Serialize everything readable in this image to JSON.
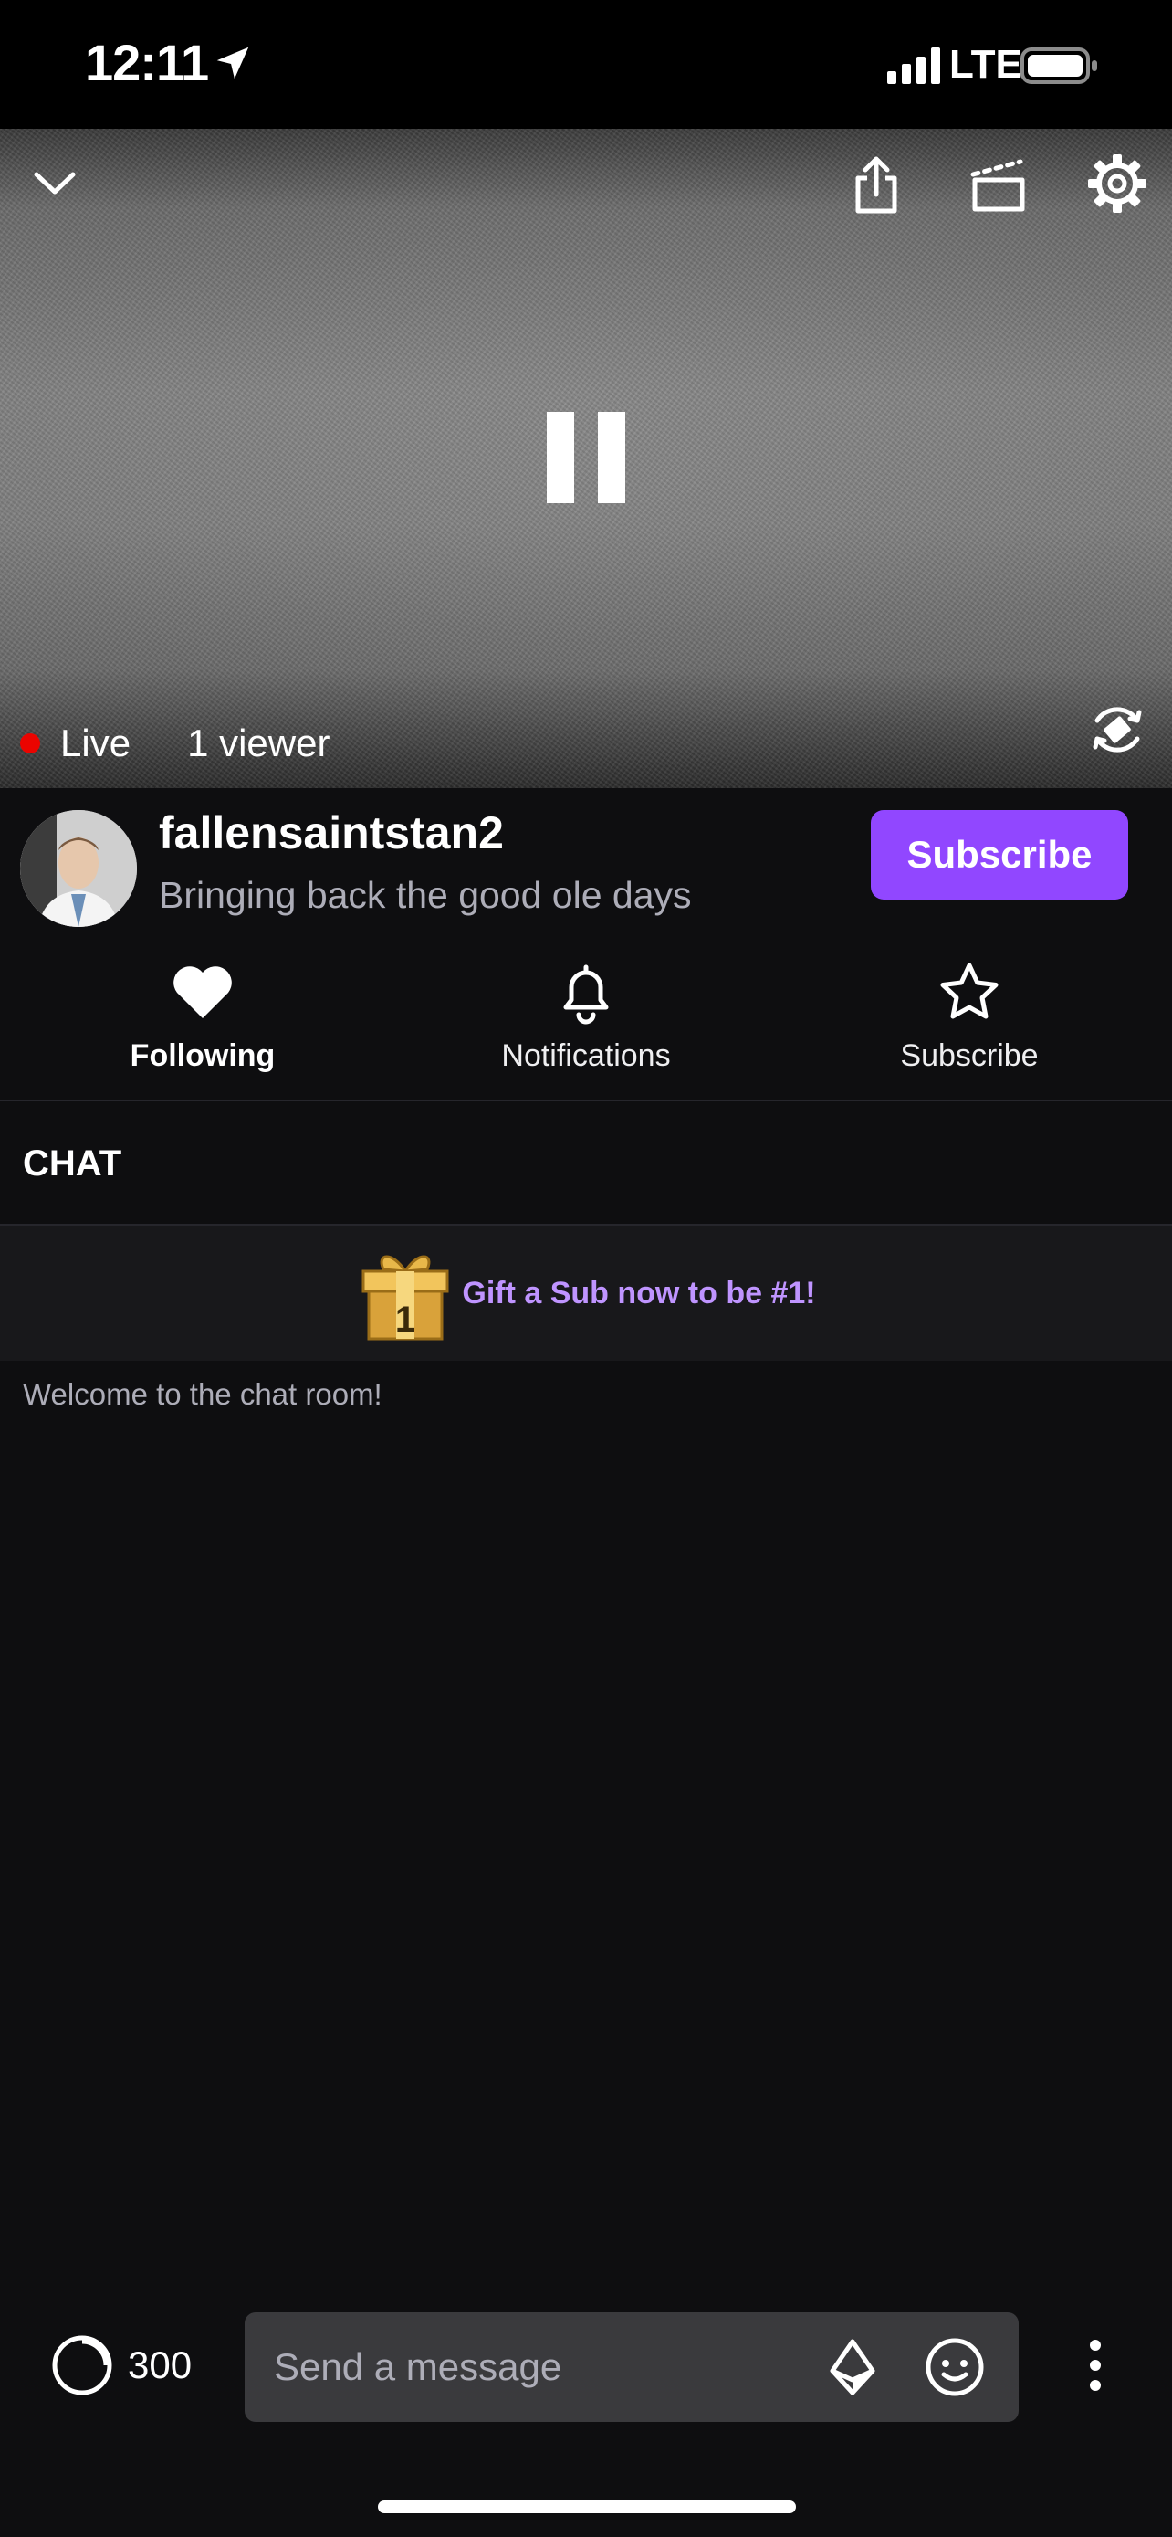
{
  "status_bar": {
    "time": "12:11",
    "network": "LTE",
    "icons": [
      "location-arrow-icon",
      "signal-bars-icon",
      "battery-icon"
    ]
  },
  "player": {
    "live_label": "Live",
    "viewer_count": "1 viewer",
    "icons": [
      "chevron-down-icon",
      "share-icon",
      "clips-icon",
      "gear-icon",
      "pause-icon",
      "fullscreen-rotate-icon"
    ],
    "live_color": "#eb0400"
  },
  "channel": {
    "name": "fallensaintstan2",
    "stream_title": "Bringing back the good ole days",
    "subscribe_button": "Subscribe",
    "accent_color": "#9147ff"
  },
  "actions": {
    "following": "Following",
    "notifications": "Notifications",
    "subscribe": "Subscribe",
    "icons": [
      "heart-icon",
      "bell-icon",
      "star-icon"
    ]
  },
  "chat": {
    "header": "CHAT",
    "gift_banner_text": "Gift a Sub now to be #1!",
    "gift_badge_number": "1",
    "welcome_message": "Welcome to the chat room!"
  },
  "composer": {
    "points": "300",
    "placeholder": "Send a message",
    "icons": [
      "channel-points-icon",
      "bits-icon",
      "emote-icon",
      "more-vertical-icon"
    ]
  }
}
